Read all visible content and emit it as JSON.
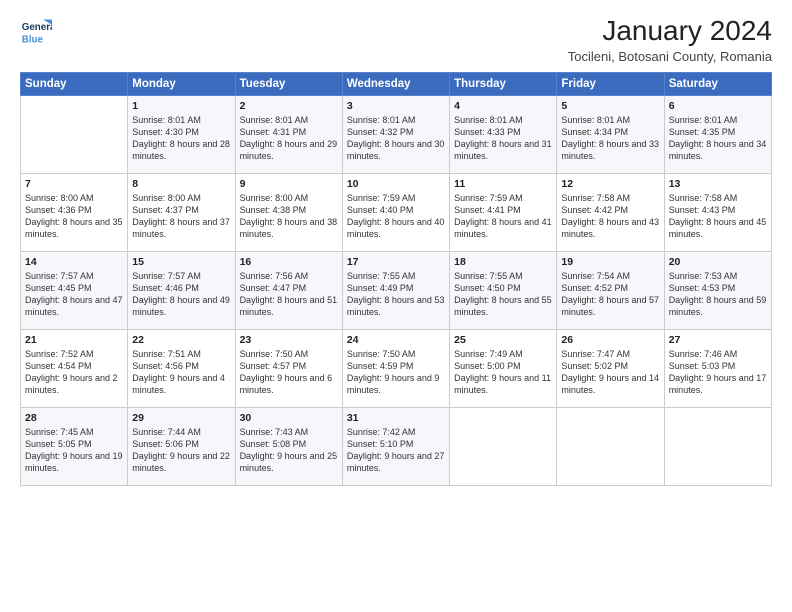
{
  "logo": {
    "line1": "General",
    "line2": "Blue"
  },
  "title": "January 2024",
  "subtitle": "Tocileni, Botosani County, Romania",
  "days_of_week": [
    "Sunday",
    "Monday",
    "Tuesday",
    "Wednesday",
    "Thursday",
    "Friday",
    "Saturday"
  ],
  "weeks": [
    [
      {
        "day": "",
        "sunrise": "",
        "sunset": "",
        "daylight": ""
      },
      {
        "day": "1",
        "sunrise": "Sunrise: 8:01 AM",
        "sunset": "Sunset: 4:30 PM",
        "daylight": "Daylight: 8 hours and 28 minutes."
      },
      {
        "day": "2",
        "sunrise": "Sunrise: 8:01 AM",
        "sunset": "Sunset: 4:31 PM",
        "daylight": "Daylight: 8 hours and 29 minutes."
      },
      {
        "day": "3",
        "sunrise": "Sunrise: 8:01 AM",
        "sunset": "Sunset: 4:32 PM",
        "daylight": "Daylight: 8 hours and 30 minutes."
      },
      {
        "day": "4",
        "sunrise": "Sunrise: 8:01 AM",
        "sunset": "Sunset: 4:33 PM",
        "daylight": "Daylight: 8 hours and 31 minutes."
      },
      {
        "day": "5",
        "sunrise": "Sunrise: 8:01 AM",
        "sunset": "Sunset: 4:34 PM",
        "daylight": "Daylight: 8 hours and 33 minutes."
      },
      {
        "day": "6",
        "sunrise": "Sunrise: 8:01 AM",
        "sunset": "Sunset: 4:35 PM",
        "daylight": "Daylight: 8 hours and 34 minutes."
      }
    ],
    [
      {
        "day": "7",
        "sunrise": "Sunrise: 8:00 AM",
        "sunset": "Sunset: 4:36 PM",
        "daylight": "Daylight: 8 hours and 35 minutes."
      },
      {
        "day": "8",
        "sunrise": "Sunrise: 8:00 AM",
        "sunset": "Sunset: 4:37 PM",
        "daylight": "Daylight: 8 hours and 37 minutes."
      },
      {
        "day": "9",
        "sunrise": "Sunrise: 8:00 AM",
        "sunset": "Sunset: 4:38 PM",
        "daylight": "Daylight: 8 hours and 38 minutes."
      },
      {
        "day": "10",
        "sunrise": "Sunrise: 7:59 AM",
        "sunset": "Sunset: 4:40 PM",
        "daylight": "Daylight: 8 hours and 40 minutes."
      },
      {
        "day": "11",
        "sunrise": "Sunrise: 7:59 AM",
        "sunset": "Sunset: 4:41 PM",
        "daylight": "Daylight: 8 hours and 41 minutes."
      },
      {
        "day": "12",
        "sunrise": "Sunrise: 7:58 AM",
        "sunset": "Sunset: 4:42 PM",
        "daylight": "Daylight: 8 hours and 43 minutes."
      },
      {
        "day": "13",
        "sunrise": "Sunrise: 7:58 AM",
        "sunset": "Sunset: 4:43 PM",
        "daylight": "Daylight: 8 hours and 45 minutes."
      }
    ],
    [
      {
        "day": "14",
        "sunrise": "Sunrise: 7:57 AM",
        "sunset": "Sunset: 4:45 PM",
        "daylight": "Daylight: 8 hours and 47 minutes."
      },
      {
        "day": "15",
        "sunrise": "Sunrise: 7:57 AM",
        "sunset": "Sunset: 4:46 PM",
        "daylight": "Daylight: 8 hours and 49 minutes."
      },
      {
        "day": "16",
        "sunrise": "Sunrise: 7:56 AM",
        "sunset": "Sunset: 4:47 PM",
        "daylight": "Daylight: 8 hours and 51 minutes."
      },
      {
        "day": "17",
        "sunrise": "Sunrise: 7:55 AM",
        "sunset": "Sunset: 4:49 PM",
        "daylight": "Daylight: 8 hours and 53 minutes."
      },
      {
        "day": "18",
        "sunrise": "Sunrise: 7:55 AM",
        "sunset": "Sunset: 4:50 PM",
        "daylight": "Daylight: 8 hours and 55 minutes."
      },
      {
        "day": "19",
        "sunrise": "Sunrise: 7:54 AM",
        "sunset": "Sunset: 4:52 PM",
        "daylight": "Daylight: 8 hours and 57 minutes."
      },
      {
        "day": "20",
        "sunrise": "Sunrise: 7:53 AM",
        "sunset": "Sunset: 4:53 PM",
        "daylight": "Daylight: 8 hours and 59 minutes."
      }
    ],
    [
      {
        "day": "21",
        "sunrise": "Sunrise: 7:52 AM",
        "sunset": "Sunset: 4:54 PM",
        "daylight": "Daylight: 9 hours and 2 minutes."
      },
      {
        "day": "22",
        "sunrise": "Sunrise: 7:51 AM",
        "sunset": "Sunset: 4:56 PM",
        "daylight": "Daylight: 9 hours and 4 minutes."
      },
      {
        "day": "23",
        "sunrise": "Sunrise: 7:50 AM",
        "sunset": "Sunset: 4:57 PM",
        "daylight": "Daylight: 9 hours and 6 minutes."
      },
      {
        "day": "24",
        "sunrise": "Sunrise: 7:50 AM",
        "sunset": "Sunset: 4:59 PM",
        "daylight": "Daylight: 9 hours and 9 minutes."
      },
      {
        "day": "25",
        "sunrise": "Sunrise: 7:49 AM",
        "sunset": "Sunset: 5:00 PM",
        "daylight": "Daylight: 9 hours and 11 minutes."
      },
      {
        "day": "26",
        "sunrise": "Sunrise: 7:47 AM",
        "sunset": "Sunset: 5:02 PM",
        "daylight": "Daylight: 9 hours and 14 minutes."
      },
      {
        "day": "27",
        "sunrise": "Sunrise: 7:46 AM",
        "sunset": "Sunset: 5:03 PM",
        "daylight": "Daylight: 9 hours and 17 minutes."
      }
    ],
    [
      {
        "day": "28",
        "sunrise": "Sunrise: 7:45 AM",
        "sunset": "Sunset: 5:05 PM",
        "daylight": "Daylight: 9 hours and 19 minutes."
      },
      {
        "day": "29",
        "sunrise": "Sunrise: 7:44 AM",
        "sunset": "Sunset: 5:06 PM",
        "daylight": "Daylight: 9 hours and 22 minutes."
      },
      {
        "day": "30",
        "sunrise": "Sunrise: 7:43 AM",
        "sunset": "Sunset: 5:08 PM",
        "daylight": "Daylight: 9 hours and 25 minutes."
      },
      {
        "day": "31",
        "sunrise": "Sunrise: 7:42 AM",
        "sunset": "Sunset: 5:10 PM",
        "daylight": "Daylight: 9 hours and 27 minutes."
      },
      {
        "day": "",
        "sunrise": "",
        "sunset": "",
        "daylight": ""
      },
      {
        "day": "",
        "sunrise": "",
        "sunset": "",
        "daylight": ""
      },
      {
        "day": "",
        "sunrise": "",
        "sunset": "",
        "daylight": ""
      }
    ]
  ]
}
